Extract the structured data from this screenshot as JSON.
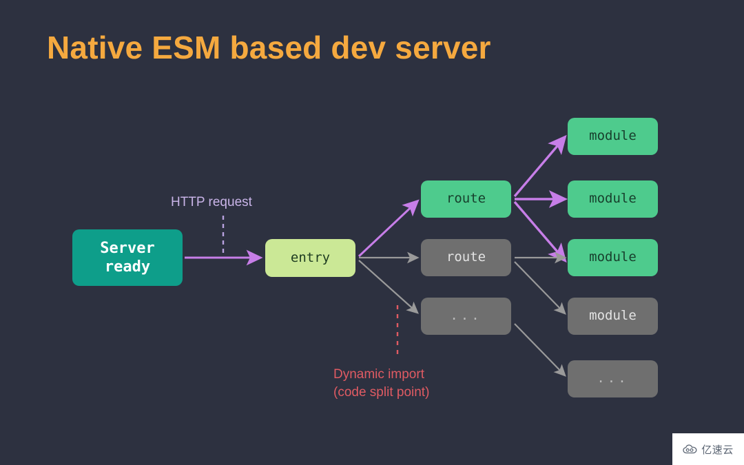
{
  "slide": {
    "title": "Native ESM based dev server",
    "background_color": "#2d3140",
    "title_color": "#f5a93f"
  },
  "colors": {
    "teal": "#0e9e8a",
    "lime": "#cbe896",
    "green": "#4ecb8d",
    "gray": "#6f6f6f",
    "purple_arrow": "#c77ee8",
    "gray_arrow": "#9a9a9a",
    "purple_label": "#c9b4e8",
    "red_label": "#e05b63"
  },
  "nodes": [
    {
      "id": "server",
      "label": "Server\nready",
      "kind": "teal",
      "text_color": "#ffffff"
    },
    {
      "id": "entry",
      "label": "entry",
      "kind": "lime",
      "text_color": "#1d3b20"
    },
    {
      "id": "route1",
      "label": "route",
      "kind": "green",
      "text_color": "#173f2c"
    },
    {
      "id": "route2",
      "label": "route",
      "kind": "gray",
      "text_color": "#e3e3e3"
    },
    {
      "id": "route3",
      "label": "...",
      "kind": "gray",
      "text_color": "#bcbcbc"
    },
    {
      "id": "module1",
      "label": "module",
      "kind": "green",
      "text_color": "#173f2c"
    },
    {
      "id": "module2",
      "label": "module",
      "kind": "green",
      "text_color": "#173f2c"
    },
    {
      "id": "module3",
      "label": "module",
      "kind": "green",
      "text_color": "#173f2c"
    },
    {
      "id": "module4",
      "label": "module",
      "kind": "gray",
      "text_color": "#e3e3e3"
    },
    {
      "id": "module5",
      "label": "...",
      "kind": "gray",
      "text_color": "#bcbcbc"
    }
  ],
  "annotations": {
    "http_request": "HTTP request",
    "dynamic_import": "Dynamic import\n(code split point)"
  },
  "watermark": {
    "text": "亿速云",
    "icon": "cloud-icon"
  }
}
